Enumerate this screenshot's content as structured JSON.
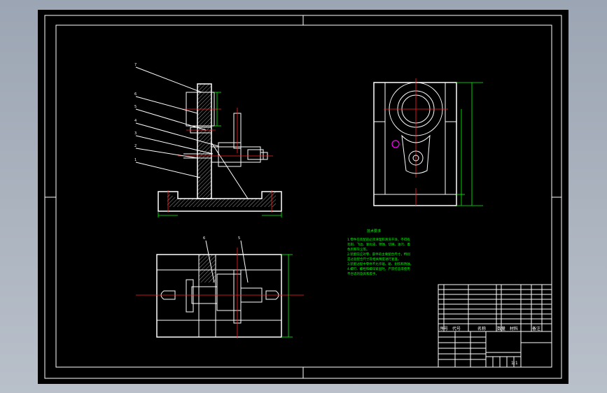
{
  "balloons": [
    "7",
    "6",
    "5",
    "4",
    "3",
    "2",
    "1"
  ],
  "top_balloons": [
    "6",
    "5"
  ],
  "tech_req_title": "技术要求",
  "tech_req_lines": [
    "1.零件在装配前必须清理和清洗干净，不得有",
    "毛刺、飞边、氧化皮、锈蚀、切屑、油污、着",
    "色剂和灰尘等。",
    "2.装配前应对零、部件的主要配合尺寸，特别",
    "是过盈配合尺寸及相关精度进行复查。",
    "3.装配过程中零件不允许磕、碰、划伤和锈蚀。",
    "4.螺钉、螺栓和螺母紧固时，严禁打击或使用",
    "不合适的旋具和扳手。"
  ],
  "title_block": {
    "header_cells": [
      "序号",
      "代号",
      "名称",
      "数量",
      "材料",
      "备注"
    ],
    "scale_label": "1:1"
  },
  "colors": {
    "line": "#ffffff",
    "dimension": "#00ff00",
    "center": "#ff2020",
    "highlight": "#ff00ff",
    "background": "#000000"
  }
}
